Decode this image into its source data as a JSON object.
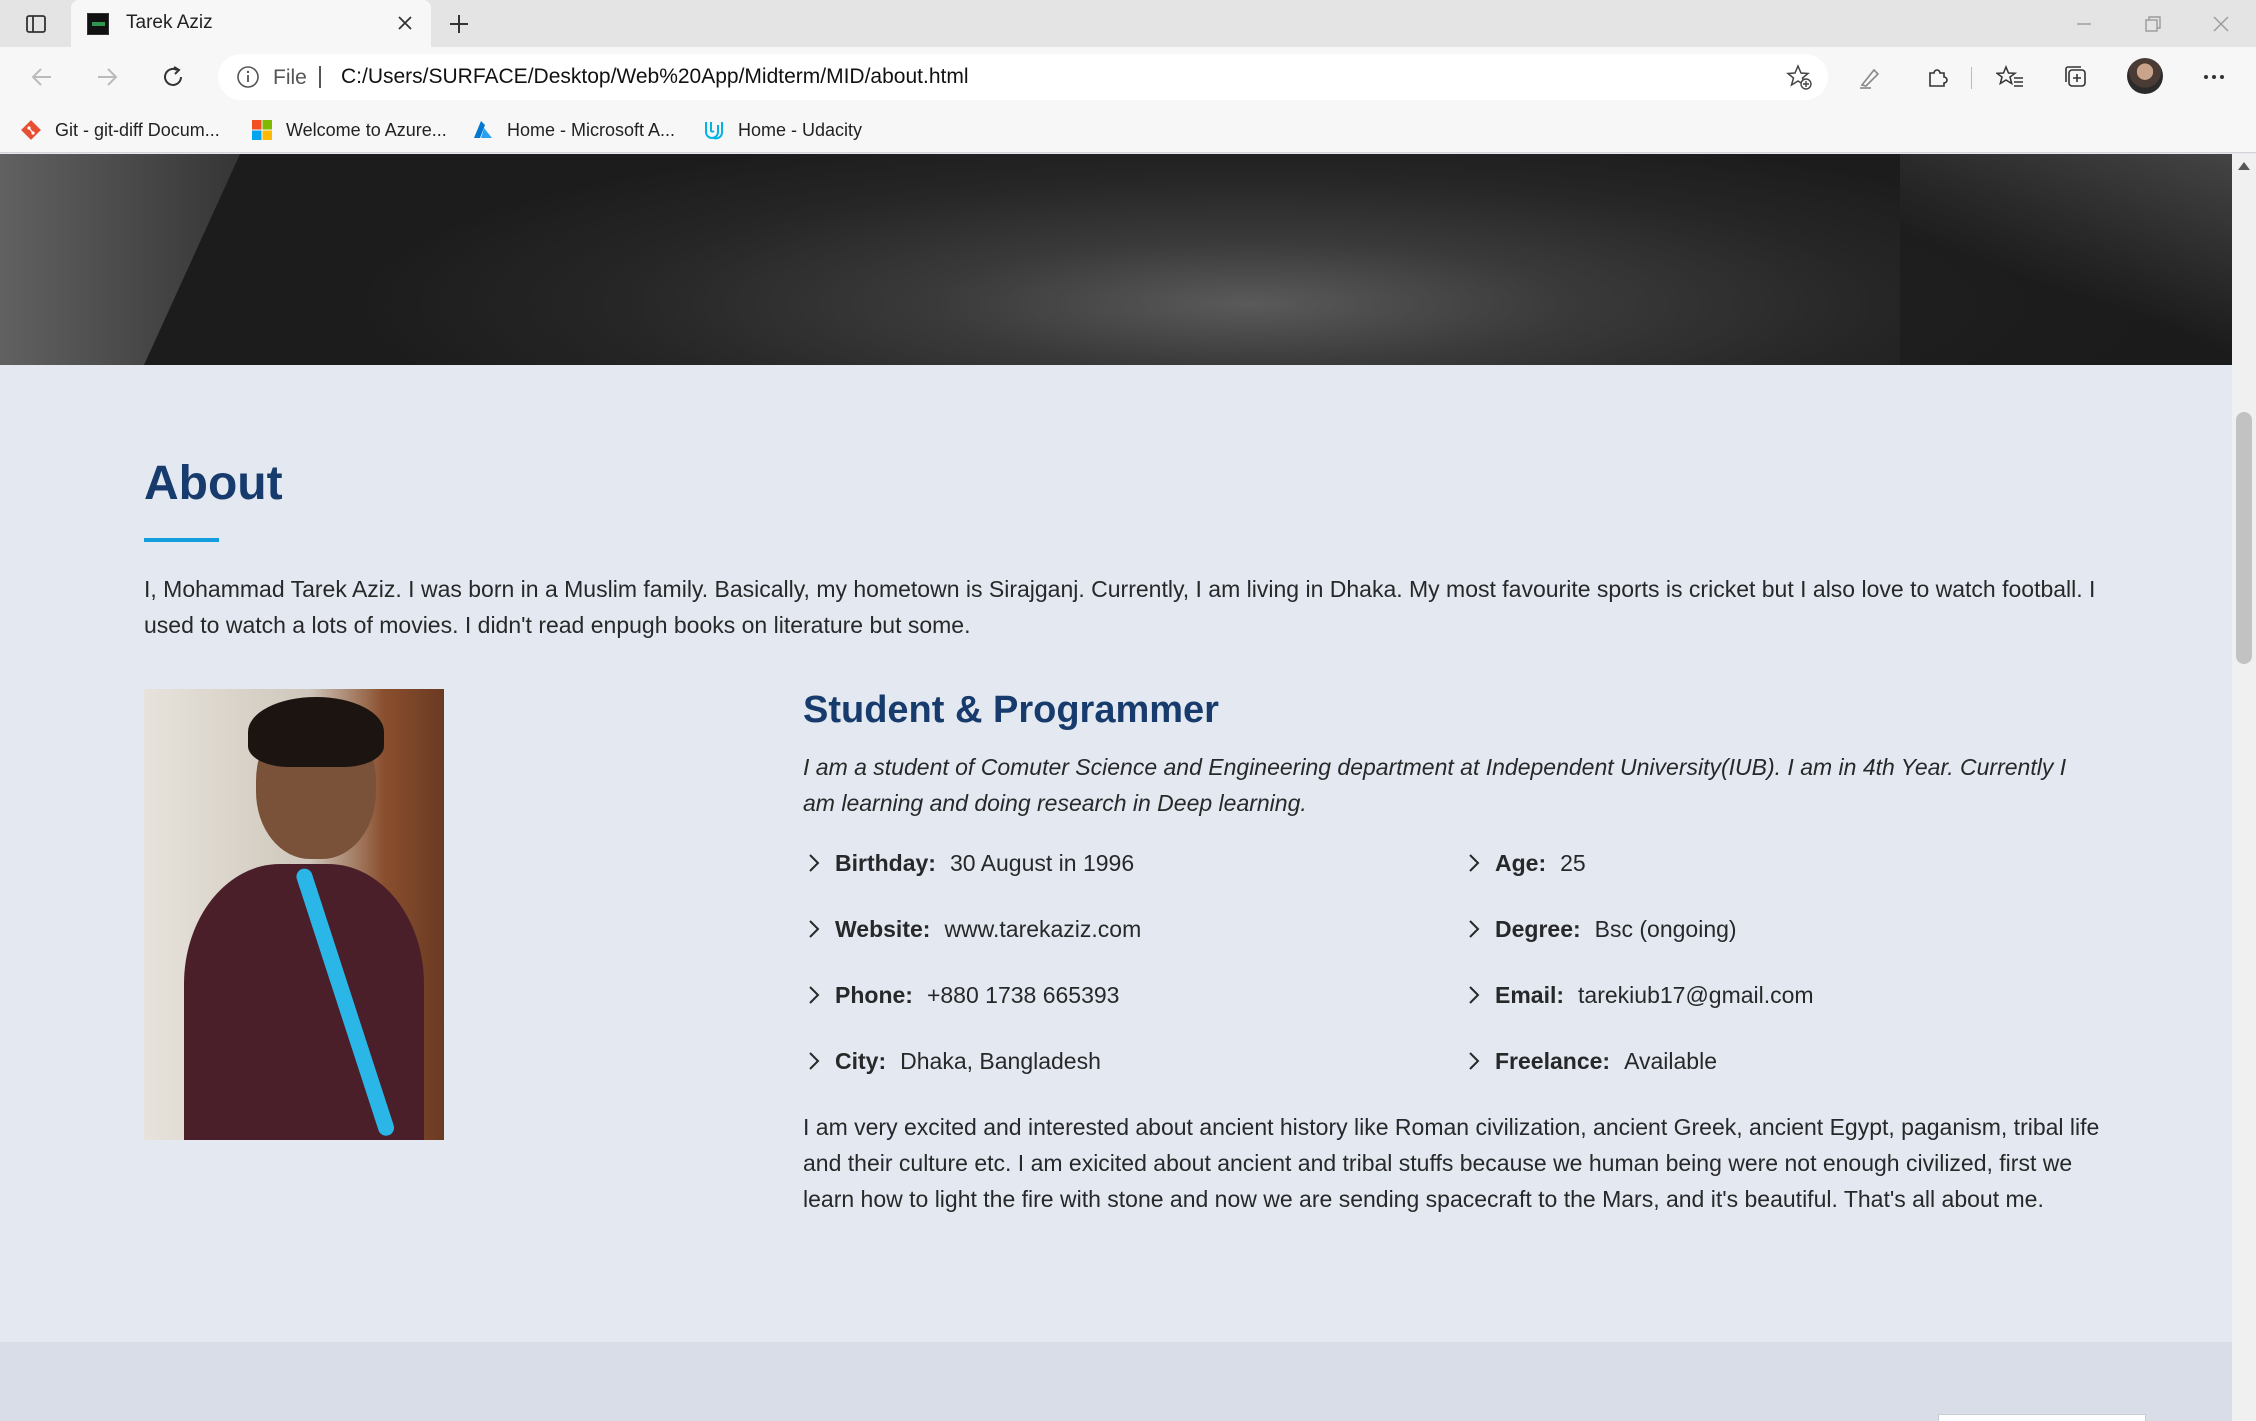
{
  "browser": {
    "tab_title": "Tarek Aziz",
    "address_scheme_label": "File",
    "address_url": "C:/Users/SURFACE/Desktop/Web%20App/Midterm/MID/about.html",
    "bookmarks": [
      {
        "label": "Git - git-diff Docum...",
        "icon": "git-icon",
        "color": "#e84e31"
      },
      {
        "label": "Welcome to Azure...",
        "icon": "microsoft-icon",
        "color": "#f25022"
      },
      {
        "label": "Home - Microsoft A...",
        "icon": "azure-icon",
        "color": "#0078d4"
      },
      {
        "label": "Home - Udacity",
        "icon": "udacity-icon",
        "color": "#02b3e4"
      }
    ]
  },
  "about": {
    "heading": "About",
    "intro": "I, Mohammad Tarek Aziz. I was born in a Muslim family. Basically, my hometown is Sirajganj. Currently, I am living in Dhaka. My most favourite sports is cricket but I also love to watch football. I used to watch a lots of movies. I didn't read enpugh books on literature but some.",
    "role_title": "Student & Programmer",
    "role_description": "I am a student of Comuter Science and Engineering department at Independent University(IUB). I am in 4th Year. Currently I am learning and doing research in Deep learning.",
    "facts_left": [
      {
        "label": "Birthday:",
        "value": "30 August in 1996"
      },
      {
        "label": "Website:",
        "value": "www.tarekaziz.com"
      },
      {
        "label": "Phone:",
        "value": "+880 1738 665393"
      },
      {
        "label": "City:",
        "value": "Dhaka, Bangladesh"
      }
    ],
    "facts_right": [
      {
        "label": "Age:",
        "value": "25"
      },
      {
        "label": "Degree:",
        "value": "Bsc (ongoing)"
      },
      {
        "label": "Email:",
        "value": "tarekiub17@gmail.com"
      },
      {
        "label": "Freelance:",
        "value": "Available"
      }
    ],
    "story": "I am very excited and interested about ancient history like Roman civilization, ancient Greek, ancient Egypt, paganism, tribal life and their culture etc. I am exicited about ancient and tribal stuffs because we human being were not enough civilized, first we learn how to light the fire with stone and now we are sending spacecraft to the Mars, and it's beautiful. That's all about me."
  },
  "colors": {
    "heading": "#173b6c",
    "accent": "#149ddd",
    "page_bg": "#e4e9f1",
    "text": "#272829"
  }
}
